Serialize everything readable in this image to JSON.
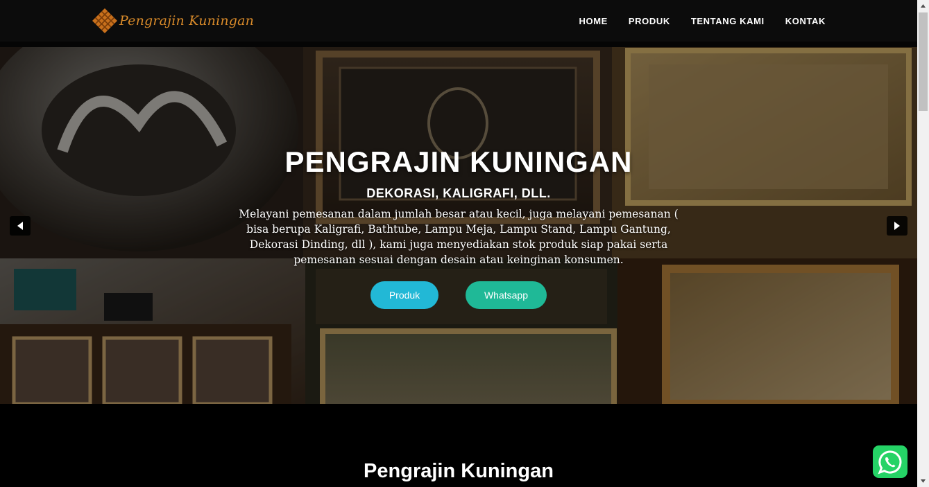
{
  "header": {
    "logo_text": "Pengrajin Kuningan",
    "nav": [
      "HOME",
      "PRODUK",
      "TENTANG KAMI",
      "KONTAK"
    ]
  },
  "hero": {
    "title": "PENGRAJIN KUNINGAN",
    "subtitle": "DEKORASI, KALIGRAFI, DLL.",
    "description": "Melayani pemesanan dalam jumlah besar atau kecil, juga melayani pemesanan ( bisa berupa Kaligrafi, Bathtube, Lampu Meja, Lampu Stand, Lampu Gantung, Dekorasi Dinding, dll ), kami juga menyediakan stok produk siap pakai serta pemesanan sesuai dengan desain atau keinginan konsumen.",
    "buttons": {
      "produk": "Produk",
      "whatsapp": "Whatsapp"
    },
    "carousel_icons": [
      "caret-left-icon",
      "caret-right-icon"
    ]
  },
  "section": {
    "title": "Pengrajin Kuningan"
  },
  "floating": {
    "icon": "whatsapp-icon"
  },
  "colors": {
    "logo": "#d88a2a",
    "produk_button": "#22b8d6",
    "whatsapp_button": "#1fb997",
    "whatsapp_float": "#25d366",
    "navbar": "#0c0c0c"
  }
}
